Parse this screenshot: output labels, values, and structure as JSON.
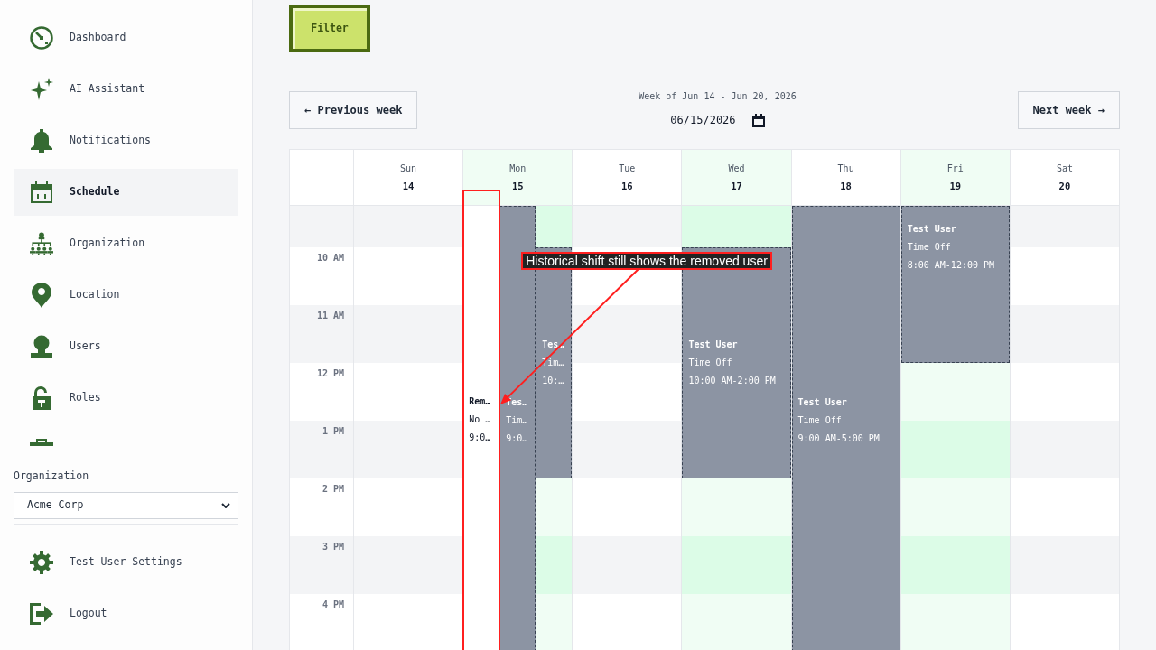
{
  "sidebar": {
    "nav_items": [
      {
        "label": "Dashboard",
        "selected": false
      },
      {
        "label": "AI Assistant",
        "selected": false
      },
      {
        "label": "Notifications",
        "selected": false
      },
      {
        "label": "Schedule",
        "selected": true
      },
      {
        "label": "Organization",
        "selected": false
      },
      {
        "label": "Location",
        "selected": false
      },
      {
        "label": "Users",
        "selected": false
      },
      {
        "label": "Roles",
        "selected": false
      }
    ],
    "organization": {
      "label": "Organization",
      "value": "Acme Corp"
    },
    "footer_items": [
      {
        "label": "Test User Settings"
      },
      {
        "label": "Logout"
      }
    ]
  },
  "toolbar": {
    "filter_button": "Filter"
  },
  "week_nav": {
    "previous": "← Previous week",
    "title": "Week of Jun 14 - Jun 20, 2026",
    "date": "06/15/2026",
    "next": "Next week →"
  },
  "calendar": {
    "time_rows": [
      "10 AM",
      "11 AM",
      "12 PM",
      "1 PM",
      "2 PM",
      "3 PM",
      "4 PM"
    ],
    "days": [
      {
        "name": "Sun",
        "date": "14",
        "highlighted": false
      },
      {
        "name": "Mon",
        "date": "15",
        "highlighted": true,
        "events": [
          {
            "kind": "shift",
            "title": "Rem…",
            "type": "No …",
            "time": "9:0…",
            "annotation": "Historical shift still shows the removed user"
          },
          {
            "kind": "time_off",
            "title": "Tes…",
            "type": "Tim…",
            "time": "9:0…"
          },
          {
            "kind": "time_off",
            "title": "Tes…",
            "type": "Tim…",
            "time": "10:…"
          }
        ]
      },
      {
        "name": "Tue",
        "date": "16",
        "highlighted": false
      },
      {
        "name": "Wed",
        "date": "17",
        "highlighted": true,
        "events": [
          {
            "kind": "time_off",
            "title": "Test User",
            "type": "Time Off",
            "time": "10:00 AM-2:00 PM"
          }
        ]
      },
      {
        "name": "Thu",
        "date": "18",
        "highlighted": false,
        "events": [
          {
            "kind": "time_off",
            "title": "Test User",
            "type": "Time Off",
            "time": "9:00 AM-5:00 PM"
          }
        ]
      },
      {
        "name": "Fri",
        "date": "19",
        "highlighted": true,
        "events": [
          {
            "kind": "time_off",
            "title": "Test User",
            "type": "Time Off",
            "time": "8:00 AM-12:00 PM"
          }
        ]
      },
      {
        "name": "Sat",
        "date": "20",
        "highlighted": false
      }
    ]
  }
}
